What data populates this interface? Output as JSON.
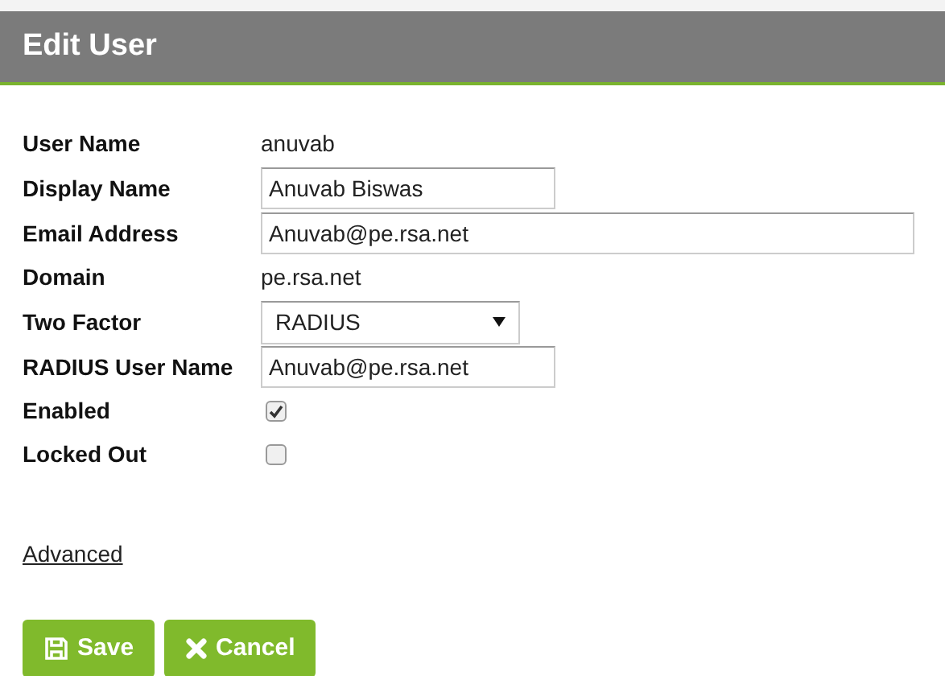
{
  "header": {
    "title": "Edit User"
  },
  "fields": [
    {
      "label": "User Name",
      "kind": "text",
      "value": "anuvab"
    },
    {
      "label": "Display Name",
      "kind": "input",
      "value": "Anuvab Biswas"
    },
    {
      "label": "Email Address",
      "kind": "wide_input",
      "value": "Anuvab@pe.rsa.net"
    },
    {
      "label": "Domain",
      "kind": "text",
      "value": "pe.rsa.net"
    },
    {
      "label": "Two Factor",
      "kind": "select",
      "value": "RADIUS"
    },
    {
      "label": "RADIUS User Name",
      "kind": "input",
      "value": "Anuvab@pe.rsa.net"
    },
    {
      "label": "Enabled",
      "kind": "checkbox",
      "checked": true
    },
    {
      "label": "Locked Out",
      "kind": "checkbox",
      "checked": false
    }
  ],
  "advanced_link": "Advanced",
  "buttons": [
    {
      "label": "Save",
      "kind": "save"
    },
    {
      "label": "Cancel",
      "kind": "cancel"
    }
  ]
}
